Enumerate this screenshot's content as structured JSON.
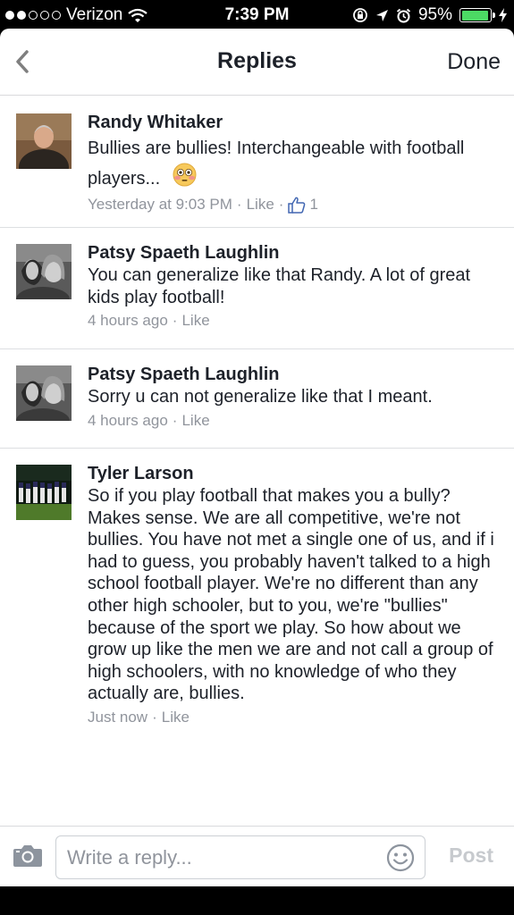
{
  "status_bar": {
    "carrier": "Verizon",
    "time": "7:39 PM",
    "battery": "95%",
    "battery_level": 0.95
  },
  "nav": {
    "title": "Replies",
    "done_label": "Done"
  },
  "comments": [
    {
      "author": "Randy Whitaker",
      "text": "Bullies are bullies!  Interchangeable with football players...",
      "time": "Yesterday at 9:03 PM",
      "like_label": "Like",
      "like_count": "1"
    },
    {
      "author": "Patsy Spaeth Laughlin",
      "text": "You can generalize like that Randy. A lot of great kids play football!",
      "time": "4 hours ago",
      "like_label": "Like"
    },
    {
      "author": "Patsy Spaeth Laughlin",
      "text": "Sorry u can not generalize like that I meant.",
      "time": "4 hours ago",
      "like_label": "Like"
    },
    {
      "author": "Tyler Larson",
      "text": "So if you play football that makes you a bully? Makes sense. We are all competitive, we're not bullies. You have not met a single one of us, and if i had to guess, you probably haven't talked to a high school football player. We're no different than any other high schooler, but to you, we're \"bullies\" because of the sport we play. So how about we grow up like the men we are and not call a group of high schoolers, with no knowledge of who they actually are, bullies.",
      "time": "Just now",
      "like_label": "Like"
    }
  ],
  "composer": {
    "placeholder": "Write a reply...",
    "post_label": "Post"
  },
  "colors": {
    "text": "#1d2129",
    "meta": "#90949c",
    "like_blue": "#4267b2",
    "battery_green": "#4cd964"
  }
}
